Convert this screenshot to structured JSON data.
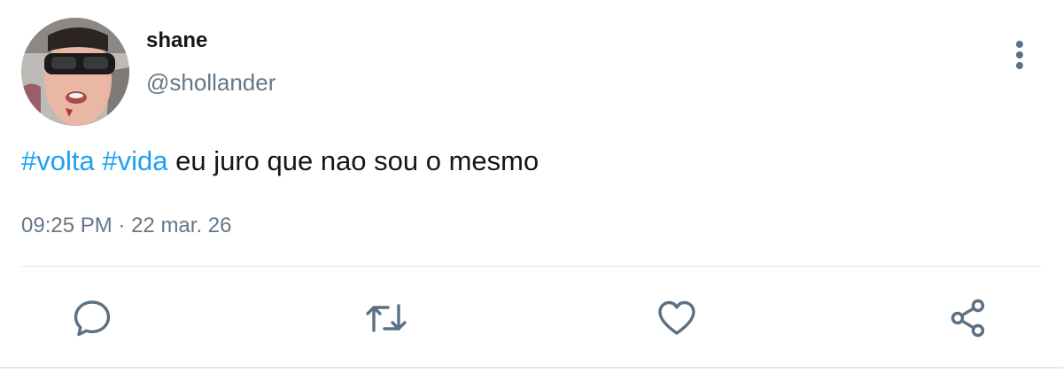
{
  "author": {
    "display_name": "shane",
    "handle": "@shollander",
    "avatar": "profile-photo"
  },
  "tweet": {
    "hashtags": [
      "#volta",
      "#vida"
    ],
    "body": "eu juro que nao sou o mesmo",
    "time": "09:25 PM",
    "separator": "·",
    "date": "22 mar. 26"
  },
  "actions": {
    "reply_icon": "speech-bubble-icon",
    "retweet_icon": "retweet-arrows-icon",
    "like_icon": "heart-icon",
    "share_icon": "share-nodes-icon",
    "more_icon": "vertical-dots-icon"
  },
  "colors": {
    "text": "#14171a",
    "secondary": "#657786",
    "hashtag": "#1da1f2",
    "icon": "#5b7083",
    "divider": "#e1e8ed"
  }
}
